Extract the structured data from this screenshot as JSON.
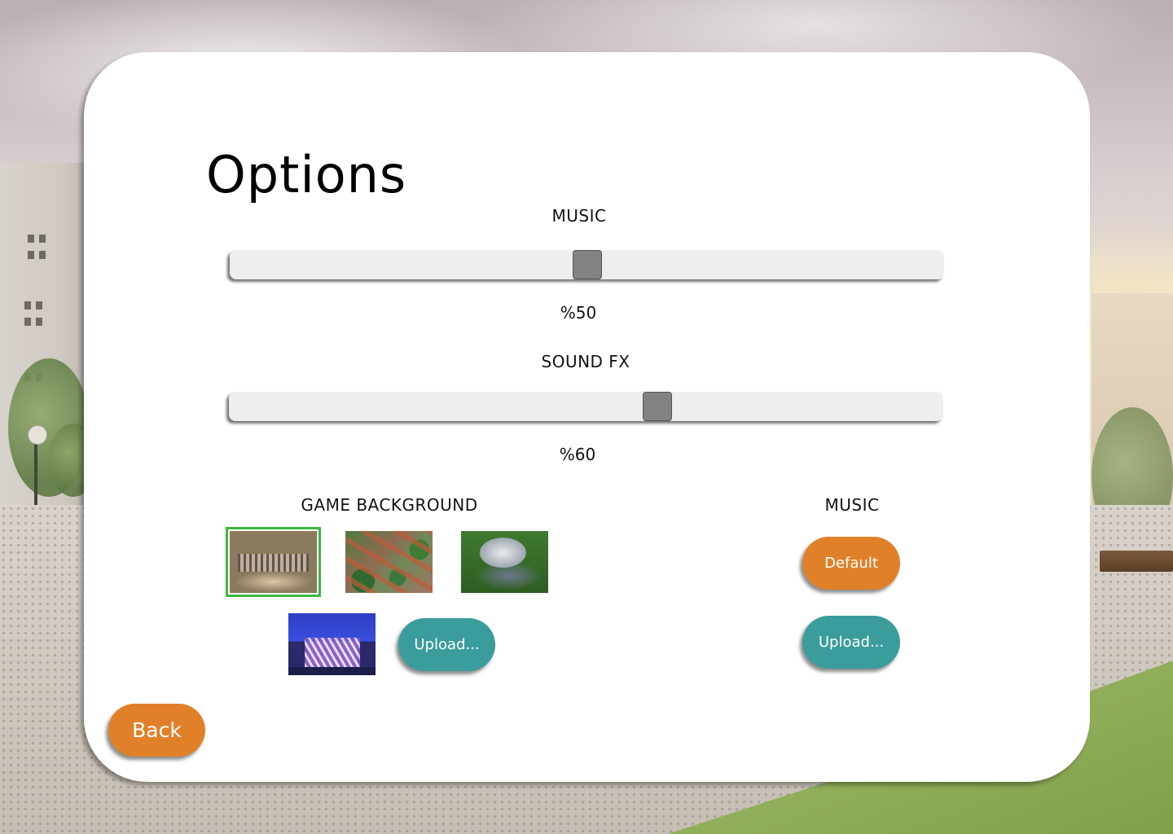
{
  "colors": {
    "accent_orange": "#e0812a",
    "accent_teal": "#3a9d9c",
    "slider_track": "#eeeeee",
    "slider_thumb": "#828282",
    "selected_outline": "#3db73d"
  },
  "page": {
    "title": "Options"
  },
  "music_volume": {
    "label": "MUSIC",
    "value": 0.5,
    "value_text": "%50"
  },
  "sound_fx_volume": {
    "label": "SOUND FX",
    "value": 0.6,
    "value_text": "%60"
  },
  "game_background": {
    "label": "GAME BACKGROUND",
    "selected_index": 0,
    "upload_label": "Upload..."
  },
  "music_track": {
    "label": "MUSIC",
    "default_label": "Default",
    "upload_label": "Upload..."
  },
  "back_label": "Back"
}
